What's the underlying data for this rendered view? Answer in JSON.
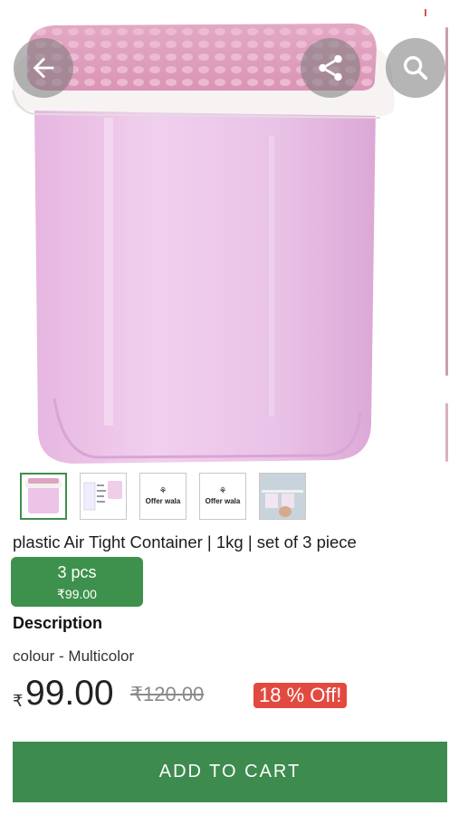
{
  "product": {
    "title": "plastic Air Tight Container | 1kg | set of 3 piece",
    "image_alt": "pink container"
  },
  "thumbnails": [
    {
      "kind": "container",
      "active": true
    },
    {
      "kind": "spec-sheet",
      "active": false
    },
    {
      "kind": "logo",
      "logo_text": "Offer wala",
      "active": false
    },
    {
      "kind": "logo",
      "logo_text": "Offer wala",
      "active": false
    },
    {
      "kind": "kitchen-shelf",
      "active": false
    }
  ],
  "variant": {
    "label": "3 pcs",
    "price": "₹99.00"
  },
  "description": {
    "heading": "Description",
    "text": "colour - Multicolor"
  },
  "pricing": {
    "currency_symbol": "₹",
    "price": "99.00",
    "mrp": "₹120.00",
    "discount": "18 % Off!"
  },
  "cart": {
    "label": "ADD TO CART"
  },
  "icons": {
    "back": "arrow-left-icon",
    "share": "share-icon",
    "search": "search-icon"
  },
  "colors": {
    "accent_green": "#3d8b4e",
    "discount_red": "#e24a3f",
    "container_pink": "#e9bfe0"
  }
}
